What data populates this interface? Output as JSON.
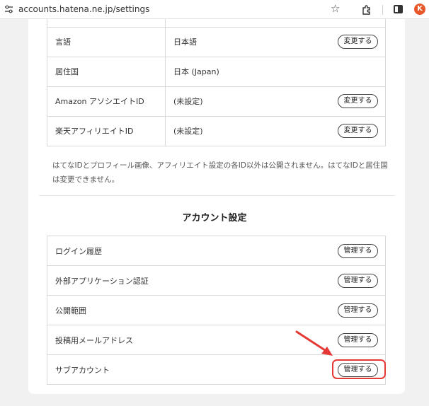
{
  "browser": {
    "url": "accounts.hatena.ne.jp/settings",
    "avatar_letter": "K"
  },
  "profile_table": {
    "rows": [
      {
        "label": "言語",
        "value": "日本語",
        "button": "変更する"
      },
      {
        "label": "居住国",
        "value": "日本 (Japan)",
        "button": ""
      },
      {
        "label": "Amazon アソシエイトID",
        "value": "(未設定)",
        "button": "変更する"
      },
      {
        "label": "楽天アフィリエイトID",
        "value": "(未設定)",
        "button": "変更する"
      }
    ]
  },
  "note": "はてなIDとプロフィール画像、アフィリエイト設定の各ID以外は公開されません。はてなIDと居住国は変更できません。",
  "account_section": {
    "title": "アカウント設定",
    "rows": [
      {
        "label": "ログイン履歴",
        "button": "管理する"
      },
      {
        "label": "外部アプリケーション認証",
        "button": "管理する"
      },
      {
        "label": "公開範囲",
        "button": "管理する"
      },
      {
        "label": "投稿用メールアドレス",
        "button": "管理する"
      },
      {
        "label": "サブアカウント",
        "button": "管理する"
      }
    ]
  },
  "colors": {
    "highlight": "#e53935",
    "avatar": "#e8572a"
  }
}
